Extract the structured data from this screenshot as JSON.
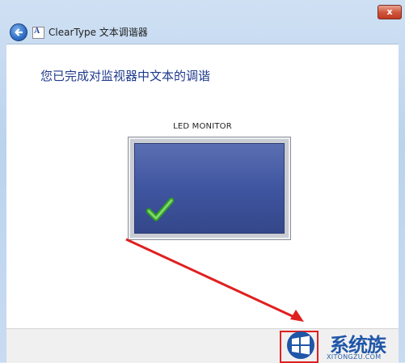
{
  "window": {
    "close_symbol": "x",
    "back_icon": "back-arrow-icon",
    "app_icon_letter": "A",
    "title": "ClearType 文本调谐器"
  },
  "main": {
    "heading": "您已完成对监视器中文本的调谐",
    "monitor_label": "LED MONITOR",
    "check_icon": "checkmark-icon"
  },
  "watermark": {
    "brand": "系统族",
    "url": "XITONGZU.COM"
  },
  "colors": {
    "heading": "#1e3a8c",
    "screen": "#3f55a0",
    "check": "#3cae2f",
    "annotation": "#e02020"
  }
}
